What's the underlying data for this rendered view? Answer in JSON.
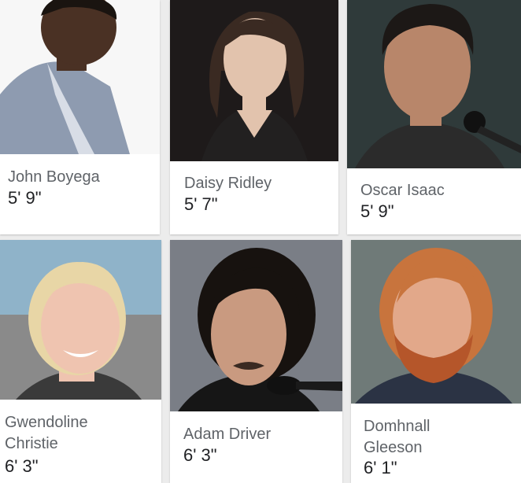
{
  "people": [
    {
      "name_lines": [
        "John Boyega"
      ],
      "height": "5' 9\"",
      "hair": "#1a1410",
      "skin": "#4a3124",
      "bg": "#f7f7f7",
      "shirt": "#8e9bb0"
    },
    {
      "name_lines": [
        "Daisy Ridley"
      ],
      "height": "5' 7\"",
      "hair": "#3a2a22",
      "skin": "#e2c3ad",
      "bg": "#1e1a1a",
      "shirt": "#222020"
    },
    {
      "name_lines": [
        "Oscar Isaac"
      ],
      "height": "5' 9\"",
      "hair": "#1c1816",
      "skin": "#b8866a",
      "bg": "#2f3a3a",
      "shirt": "#2b2b2b"
    },
    {
      "name_lines": [
        "Gwendoline",
        "Christie"
      ],
      "height": "6' 3\"",
      "hair": "#e8d6a6",
      "skin": "#efc4b0",
      "bg": "#8fb3c9",
      "shirt": "#3a3a3a"
    },
    {
      "name_lines": [
        "Adam Driver"
      ],
      "height": "6' 3\"",
      "hair": "#17120f",
      "skin": "#c99a80",
      "bg": "#7a7e86",
      "shirt": "#161616"
    },
    {
      "name_lines": [
        "Domhnall",
        "Gleeson"
      ],
      "height": "6' 1\"",
      "hair": "#c8743d",
      "skin": "#e2a88a",
      "bg": "#6f7a78",
      "shirt": "#2b3344"
    }
  ]
}
